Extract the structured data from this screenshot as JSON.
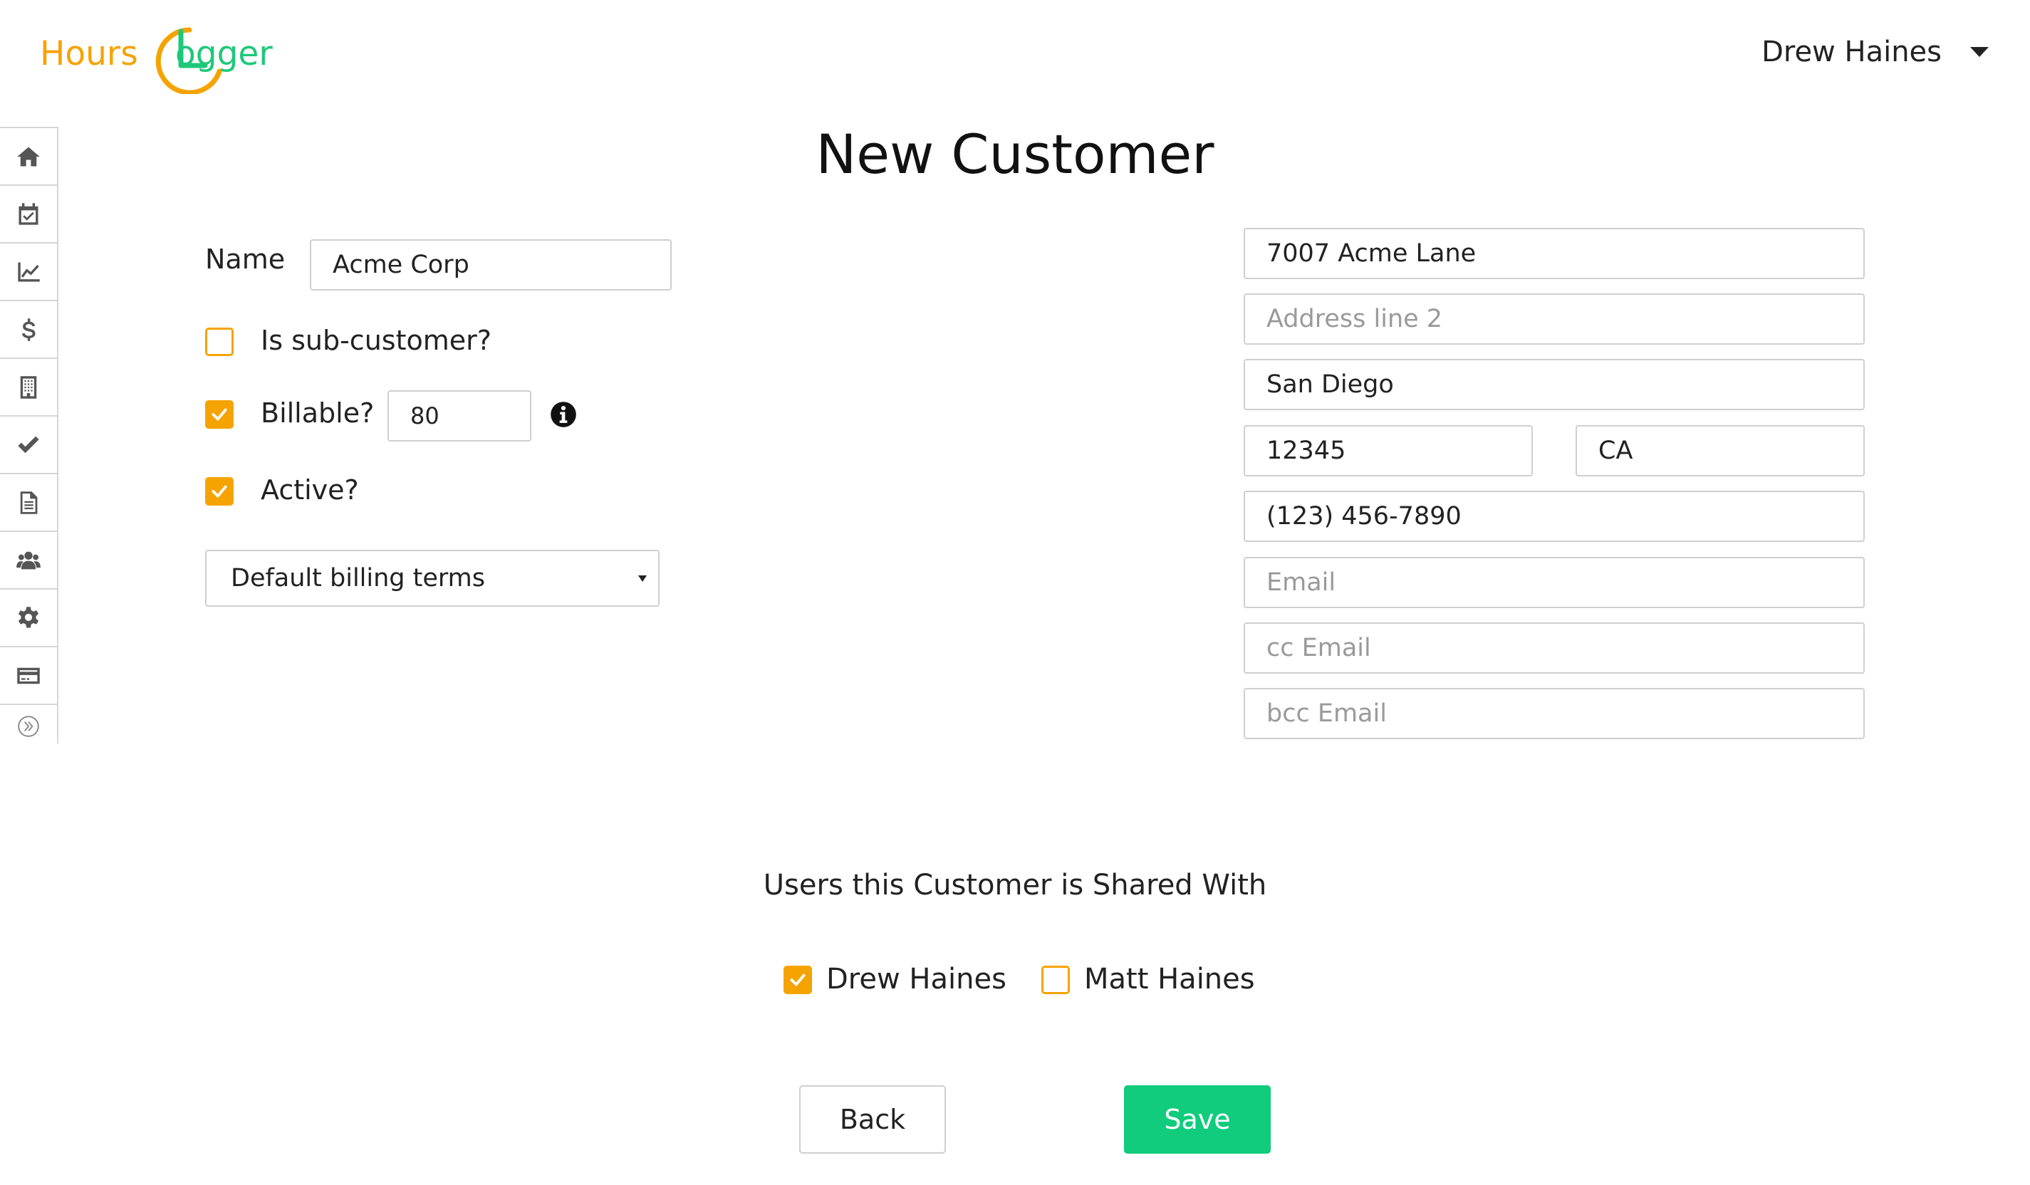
{
  "logo": {
    "hours": "Hours",
    "logger": "ogger",
    "ring_letter": "L",
    "colors": {
      "orange": "#f5a300",
      "green": "#1ec87a"
    }
  },
  "user_menu": {
    "name": "Drew Haines",
    "icon": "caret-down-icon"
  },
  "sidebar": {
    "items": [
      {
        "name": "home",
        "icon": "home-icon"
      },
      {
        "name": "calendar",
        "icon": "calendar-check-icon"
      },
      {
        "name": "reports",
        "icon": "line-chart-icon"
      },
      {
        "name": "billing",
        "icon": "dollar-icon"
      },
      {
        "name": "customers",
        "icon": "building-icon"
      },
      {
        "name": "tasks",
        "icon": "check-icon"
      },
      {
        "name": "invoices",
        "icon": "document-icon"
      },
      {
        "name": "users",
        "icon": "users-icon"
      },
      {
        "name": "settings",
        "icon": "gear-icon"
      },
      {
        "name": "payments",
        "icon": "credit-card-icon"
      },
      {
        "name": "expand",
        "icon": "double-chevron-right-icon"
      }
    ]
  },
  "page": {
    "title": "New Customer"
  },
  "form": {
    "name_label": "Name",
    "name_value": "Acme Corp",
    "sub_customer_label": "Is sub-customer?",
    "sub_customer_checked": false,
    "billable_label": "Billable?",
    "billable_checked": true,
    "billable_rate": "80",
    "active_label": "Active?",
    "active_checked": true,
    "billing_terms": "Default billing terms"
  },
  "address": {
    "line1": "7007 Acme Lane",
    "line2_placeholder": "Address line 2",
    "city": "San Diego",
    "zip": "12345",
    "state": "CA",
    "phone": "(123) 456-7890",
    "email_placeholder": "Email",
    "cc_email_placeholder": "cc Email",
    "bcc_email_placeholder": "bcc Email"
  },
  "shared": {
    "title": "Users this Customer is Shared With",
    "users": [
      {
        "name": "Drew Haines",
        "checked": true
      },
      {
        "name": "Matt Haines",
        "checked": false
      }
    ]
  },
  "buttons": {
    "back": "Back",
    "save": "Save"
  },
  "colors": {
    "accent_orange": "#f5a300",
    "save_green": "#10cc7c",
    "border": "#cfcfcf"
  }
}
